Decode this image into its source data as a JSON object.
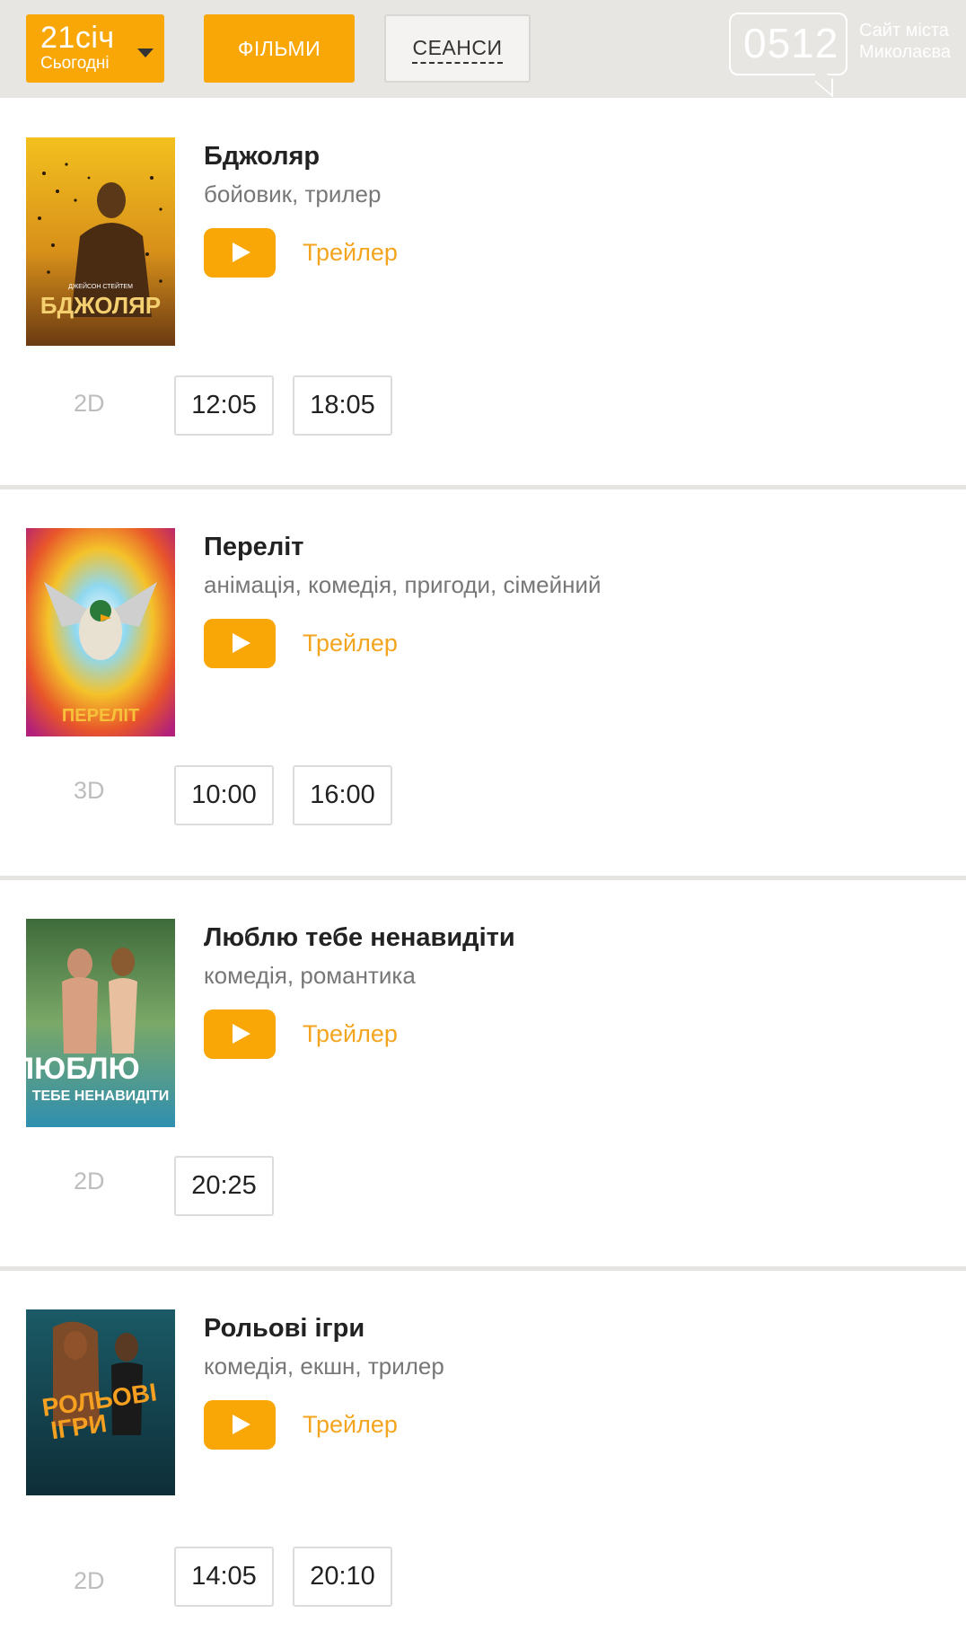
{
  "header": {
    "date_main": "21січ",
    "date_sub": "Сьогодні",
    "tab_films": "ФІЛЬМИ",
    "tab_sessions": "СЕАНСИ",
    "logo_number": "0512",
    "logo_text_line1": "Сайт міста",
    "logo_text_line2": "Миколаєва"
  },
  "movies": [
    {
      "title": "Бджоляр",
      "genres": "бойовик, трилер",
      "trailer_label": "Трейлер",
      "poster_text": "БДЖОЛЯР",
      "poster_caption": "ДЖЕЙСОН СТЕЙТЕМ",
      "format": "2D",
      "times": [
        "12:05",
        "18:05"
      ]
    },
    {
      "title": "Переліт",
      "genres": "анімація, комедія, пригоди, сімейний",
      "trailer_label": "Трейлер",
      "poster_text": "ПЕРЕЛІТ",
      "poster_caption": "",
      "format": "3D",
      "times": [
        "10:00",
        "16:00"
      ]
    },
    {
      "title": "Люблю тебе ненавидіти",
      "genres": "комедія, романтика",
      "trailer_label": "Трейлер",
      "poster_text": "ЛЮБЛЮ",
      "poster_caption": "ТЕБЕ НЕНАВИДІТИ",
      "format": "2D",
      "times": [
        "20:25"
      ]
    },
    {
      "title": "Рольові ігри",
      "genres": "комедія, екшн, трилер",
      "trailer_label": "Трейлер",
      "poster_text": "РОЛЬОВІ",
      "poster_caption": "ІГРИ",
      "format": "2D",
      "times": [
        "14:05",
        "20:10"
      ]
    }
  ],
  "colors": {
    "accent": "#f9a707",
    "header_bg": "#e8e6e3",
    "trailer_text": "#f3a51f",
    "format_text": "#bdbdbd"
  }
}
